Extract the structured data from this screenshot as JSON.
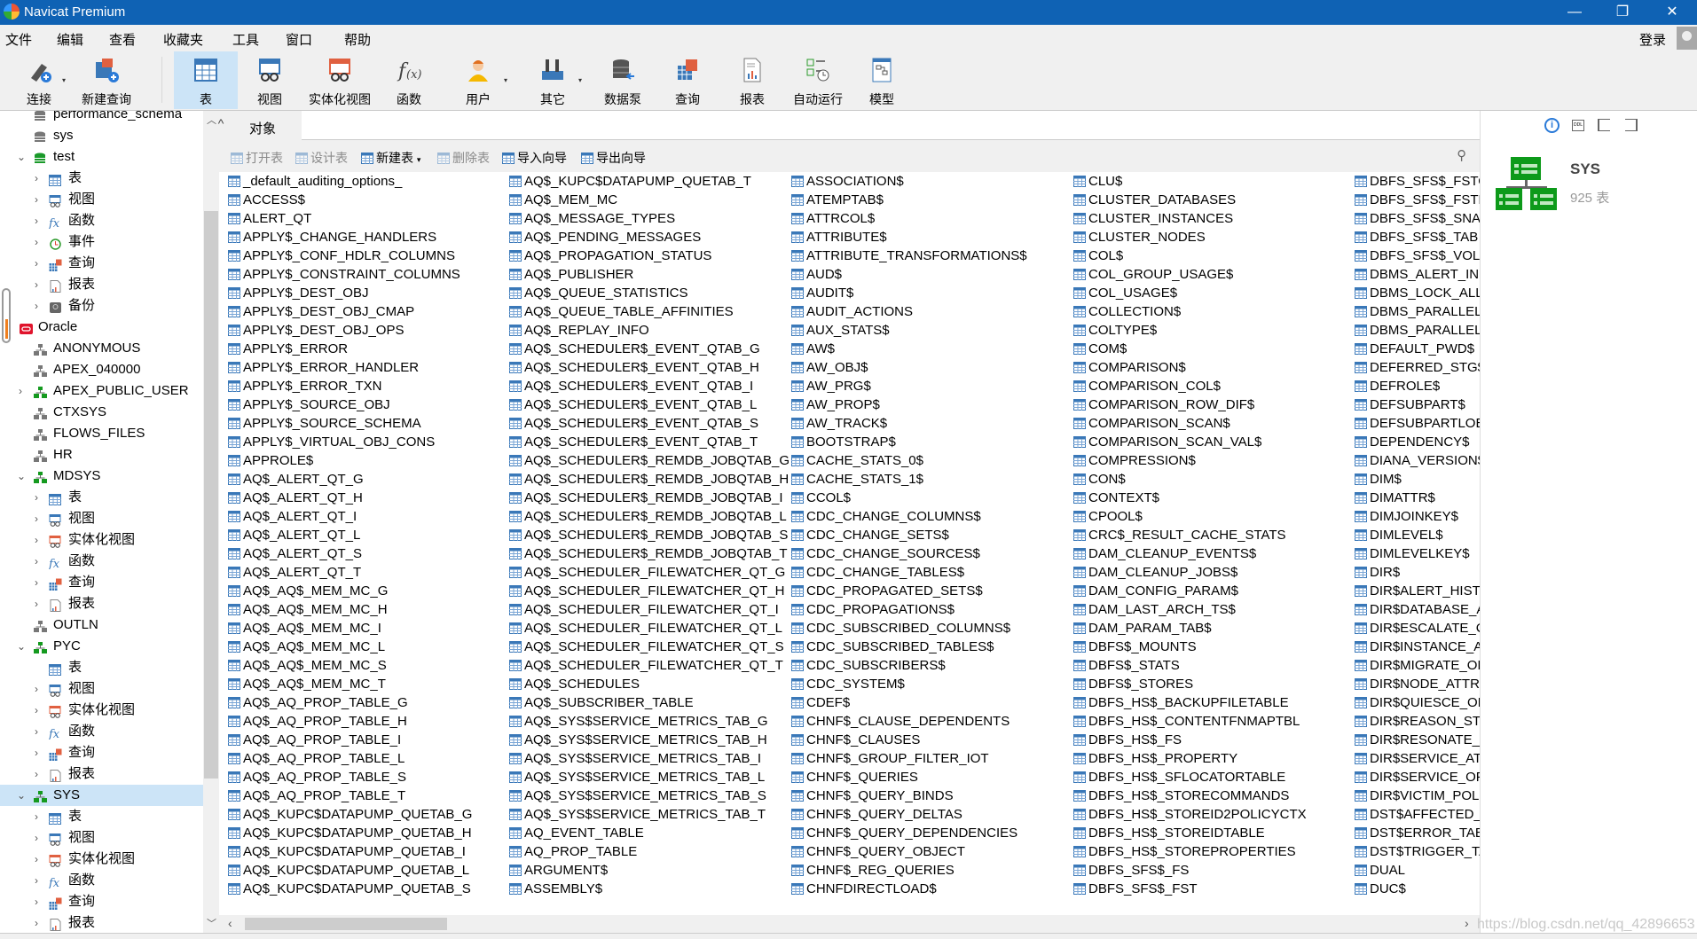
{
  "window": {
    "title": "Navicat Premium",
    "minimize": "—",
    "restore": "❐",
    "close": "✕"
  },
  "menu": [
    "文件",
    "编辑",
    "查看",
    "收藏夹",
    "工具",
    "窗口",
    "帮助"
  ],
  "login": "登录",
  "toolbar": [
    {
      "label": "连接",
      "icon": "connection-icon",
      "drop": true
    },
    {
      "label": "新建查询",
      "icon": "new-query-icon"
    },
    {
      "label": "表",
      "icon": "table-icon",
      "selected": true
    },
    {
      "label": "视图",
      "icon": "view-icon"
    },
    {
      "label": "实体化视图",
      "icon": "materialized-view-icon"
    },
    {
      "label": "函数",
      "icon": "function-icon"
    },
    {
      "label": "用户",
      "icon": "user-icon",
      "drop": true
    },
    {
      "label": "其它",
      "icon": "tools-icon",
      "drop": true
    },
    {
      "label": "数据泵",
      "icon": "data-pump-icon"
    },
    {
      "label": "查询",
      "icon": "query-icon"
    },
    {
      "label": "报表",
      "icon": "report-icon"
    },
    {
      "label": "自动运行",
      "icon": "automation-icon"
    },
    {
      "label": "模型",
      "icon": "model-icon"
    }
  ],
  "sidebar": [
    {
      "label": "performance_schema",
      "level": 1,
      "icon": "database-grey"
    },
    {
      "label": "sys",
      "level": 1,
      "icon": "database-grey"
    },
    {
      "label": "test",
      "level": 1,
      "icon": "database-green",
      "expanded": true
    },
    {
      "label": "表",
      "level": 2,
      "icon": "table",
      "chev": true
    },
    {
      "label": "视图",
      "level": 2,
      "icon": "view",
      "chev": true
    },
    {
      "label": "函数",
      "level": 2,
      "icon": "function",
      "chev": true
    },
    {
      "label": "事件",
      "level": 2,
      "icon": "event",
      "chev": true
    },
    {
      "label": "查询",
      "level": 2,
      "icon": "query",
      "chev": true
    },
    {
      "label": "报表",
      "level": 2,
      "icon": "report",
      "chev": true
    },
    {
      "label": "备份",
      "level": 2,
      "icon": "backup",
      "chev": true
    },
    {
      "label": "Oracle",
      "level": 0,
      "icon": "oracle"
    },
    {
      "label": "ANONYMOUS",
      "level": 1,
      "icon": "schema-grey"
    },
    {
      "label": "APEX_040000",
      "level": 1,
      "icon": "schema-grey"
    },
    {
      "label": "APEX_PUBLIC_USER",
      "level": 1,
      "icon": "schema-green",
      "chev": true
    },
    {
      "label": "CTXSYS",
      "level": 1,
      "icon": "schema-grey"
    },
    {
      "label": "FLOWS_FILES",
      "level": 1,
      "icon": "schema-grey"
    },
    {
      "label": "HR",
      "level": 1,
      "icon": "schema-grey"
    },
    {
      "label": "MDSYS",
      "level": 1,
      "icon": "schema-green",
      "expanded": true
    },
    {
      "label": "表",
      "level": 2,
      "icon": "table",
      "chev": true
    },
    {
      "label": "视图",
      "level": 2,
      "icon": "view",
      "chev": true
    },
    {
      "label": "实体化视图",
      "level": 2,
      "icon": "mview",
      "chev": true
    },
    {
      "label": "函数",
      "level": 2,
      "icon": "function",
      "chev": true
    },
    {
      "label": "查询",
      "level": 2,
      "icon": "query",
      "chev": true
    },
    {
      "label": "报表",
      "level": 2,
      "icon": "report",
      "chev": true
    },
    {
      "label": "OUTLN",
      "level": 1,
      "icon": "schema-grey"
    },
    {
      "label": "PYC",
      "level": 1,
      "icon": "schema-green",
      "expanded": true
    },
    {
      "label": "表",
      "level": 2,
      "icon": "table"
    },
    {
      "label": "视图",
      "level": 2,
      "icon": "view",
      "chev": true
    },
    {
      "label": "实体化视图",
      "level": 2,
      "icon": "mview",
      "chev": true
    },
    {
      "label": "函数",
      "level": 2,
      "icon": "function",
      "chev": true
    },
    {
      "label": "查询",
      "level": 2,
      "icon": "query",
      "chev": true
    },
    {
      "label": "报表",
      "level": 2,
      "icon": "report",
      "chev": true
    },
    {
      "label": "SYS",
      "level": 1,
      "icon": "schema-green",
      "expanded": true,
      "selected": true
    },
    {
      "label": "表",
      "level": 2,
      "icon": "table",
      "chev": true
    },
    {
      "label": "视图",
      "level": 2,
      "icon": "view",
      "chev": true
    },
    {
      "label": "实体化视图",
      "level": 2,
      "icon": "mview",
      "chev": true
    },
    {
      "label": "函数",
      "level": 2,
      "icon": "function",
      "chev": true
    },
    {
      "label": "查询",
      "level": 2,
      "icon": "query",
      "chev": true
    },
    {
      "label": "报表",
      "level": 2,
      "icon": "report",
      "chev": true
    }
  ],
  "tabs": {
    "collapse": "^",
    "active": "对象"
  },
  "object_toolbar": [
    {
      "label": "打开表",
      "disabled": true
    },
    {
      "label": "设计表",
      "disabled": true
    },
    {
      "label": "新建表",
      "disabled": false,
      "drop": true
    },
    {
      "label": "删除表",
      "disabled": true
    },
    {
      "label": "导入向导",
      "disabled": false
    },
    {
      "label": "导出向导",
      "disabled": false
    }
  ],
  "tables": [
    [
      "_default_auditing_options_",
      "ACCESS$",
      "ALERT_QT",
      "APPLY$_CHANGE_HANDLERS",
      "APPLY$_CONF_HDLR_COLUMNS",
      "APPLY$_CONSTRAINT_COLUMNS",
      "APPLY$_DEST_OBJ",
      "APPLY$_DEST_OBJ_CMAP",
      "APPLY$_DEST_OBJ_OPS",
      "APPLY$_ERROR",
      "APPLY$_ERROR_HANDLER",
      "APPLY$_ERROR_TXN",
      "APPLY$_SOURCE_OBJ",
      "APPLY$_SOURCE_SCHEMA",
      "APPLY$_VIRTUAL_OBJ_CONS",
      "APPROLE$",
      "AQ$_ALERT_QT_G",
      "AQ$_ALERT_QT_H",
      "AQ$_ALERT_QT_I",
      "AQ$_ALERT_QT_L",
      "AQ$_ALERT_QT_S",
      "AQ$_ALERT_QT_T",
      "AQ$_AQ$_MEM_MC_G",
      "AQ$_AQ$_MEM_MC_H",
      "AQ$_AQ$_MEM_MC_I",
      "AQ$_AQ$_MEM_MC_L",
      "AQ$_AQ$_MEM_MC_S",
      "AQ$_AQ$_MEM_MC_T",
      "AQ$_AQ_PROP_TABLE_G",
      "AQ$_AQ_PROP_TABLE_H",
      "AQ$_AQ_PROP_TABLE_I",
      "AQ$_AQ_PROP_TABLE_L",
      "AQ$_AQ_PROP_TABLE_S",
      "AQ$_AQ_PROP_TABLE_T",
      "AQ$_KUPC$DATAPUMP_QUETAB_G",
      "AQ$_KUPC$DATAPUMP_QUETAB_H",
      "AQ$_KUPC$DATAPUMP_QUETAB_I",
      "AQ$_KUPC$DATAPUMP_QUETAB_L",
      "AQ$_KUPC$DATAPUMP_QUETAB_S"
    ],
    [
      "AQ$_KUPC$DATAPUMP_QUETAB_T",
      "AQ$_MEM_MC",
      "AQ$_MESSAGE_TYPES",
      "AQ$_PENDING_MESSAGES",
      "AQ$_PROPAGATION_STATUS",
      "AQ$_PUBLISHER",
      "AQ$_QUEUE_STATISTICS",
      "AQ$_QUEUE_TABLE_AFFINITIES",
      "AQ$_REPLAY_INFO",
      "AQ$_SCHEDULER$_EVENT_QTAB_G",
      "AQ$_SCHEDULER$_EVENT_QTAB_H",
      "AQ$_SCHEDULER$_EVENT_QTAB_I",
      "AQ$_SCHEDULER$_EVENT_QTAB_L",
      "AQ$_SCHEDULER$_EVENT_QTAB_S",
      "AQ$_SCHEDULER$_EVENT_QTAB_T",
      "AQ$_SCHEDULER$_REMDB_JOBQTAB_G",
      "AQ$_SCHEDULER$_REMDB_JOBQTAB_H",
      "AQ$_SCHEDULER$_REMDB_JOBQTAB_I",
      "AQ$_SCHEDULER$_REMDB_JOBQTAB_L",
      "AQ$_SCHEDULER$_REMDB_JOBQTAB_S",
      "AQ$_SCHEDULER$_REMDB_JOBQTAB_T",
      "AQ$_SCHEDULER_FILEWATCHER_QT_G",
      "AQ$_SCHEDULER_FILEWATCHER_QT_H",
      "AQ$_SCHEDULER_FILEWATCHER_QT_I",
      "AQ$_SCHEDULER_FILEWATCHER_QT_L",
      "AQ$_SCHEDULER_FILEWATCHER_QT_S",
      "AQ$_SCHEDULER_FILEWATCHER_QT_T",
      "AQ$_SCHEDULES",
      "AQ$_SUBSCRIBER_TABLE",
      "AQ$_SYS$SERVICE_METRICS_TAB_G",
      "AQ$_SYS$SERVICE_METRICS_TAB_H",
      "AQ$_SYS$SERVICE_METRICS_TAB_I",
      "AQ$_SYS$SERVICE_METRICS_TAB_L",
      "AQ$_SYS$SERVICE_METRICS_TAB_S",
      "AQ$_SYS$SERVICE_METRICS_TAB_T",
      "AQ_EVENT_TABLE",
      "AQ_PROP_TABLE",
      "ARGUMENT$",
      "ASSEMBLY$"
    ],
    [
      "ASSOCIATION$",
      "ATEMPTAB$",
      "ATTRCOL$",
      "ATTRIBUTE$",
      "ATTRIBUTE_TRANSFORMATIONS$",
      "AUD$",
      "AUDIT$",
      "AUDIT_ACTIONS",
      "AUX_STATS$",
      "AW$",
      "AW_OBJ$",
      "AW_PRG$",
      "AW_PROP$",
      "AW_TRACK$",
      "BOOTSTRAP$",
      "CACHE_STATS_0$",
      "CACHE_STATS_1$",
      "CCOL$",
      "CDC_CHANGE_COLUMNS$",
      "CDC_CHANGE_SETS$",
      "CDC_CHANGE_SOURCES$",
      "CDC_CHANGE_TABLES$",
      "CDC_PROPAGATED_SETS$",
      "CDC_PROPAGATIONS$",
      "CDC_SUBSCRIBED_COLUMNS$",
      "CDC_SUBSCRIBED_TABLES$",
      "CDC_SUBSCRIBERS$",
      "CDC_SYSTEM$",
      "CDEF$",
      "CHNF$_CLAUSE_DEPENDENTS",
      "CHNF$_CLAUSES",
      "CHNF$_GROUP_FILTER_IOT",
      "CHNF$_QUERIES",
      "CHNF$_QUERY_BINDS",
      "CHNF$_QUERY_DELTAS",
      "CHNF$_QUERY_DEPENDENCIES",
      "CHNF$_QUERY_OBJECT",
      "CHNF$_REG_QUERIES",
      "CHNFDIRECTLOAD$"
    ],
    [
      "CLU$",
      "CLUSTER_DATABASES",
      "CLUSTER_INSTANCES",
      "CLUSTER_NODES",
      "COL$",
      "COL_GROUP_USAGE$",
      "COL_USAGE$",
      "COLLECTION$",
      "COLTYPE$",
      "COM$",
      "COMPARISON$",
      "COMPARISON_COL$",
      "COMPARISON_ROW_DIF$",
      "COMPARISON_SCAN$",
      "COMPARISON_SCAN_VAL$",
      "COMPRESSION$",
      "CON$",
      "CONTEXT$",
      "CPOOL$",
      "CRC$_RESULT_CACHE_STATS",
      "DAM_CLEANUP_EVENTS$",
      "DAM_CLEANUP_JOBS$",
      "DAM_CONFIG_PARAM$",
      "DAM_LAST_ARCH_TS$",
      "DAM_PARAM_TAB$",
      "DBFS$_MOUNTS",
      "DBFS$_STATS",
      "DBFS$_STORES",
      "DBFS_HS$_BACKUPFILETABLE",
      "DBFS_HS$_CONTENTFNMAPTBL",
      "DBFS_HS$_FS",
      "DBFS_HS$_PROPERTY",
      "DBFS_HS$_SFLOCATORTABLE",
      "DBFS_HS$_STORECOMMANDS",
      "DBFS_HS$_STOREID2POLICYCTX",
      "DBFS_HS$_STOREIDTABLE",
      "DBFS_HS$_STOREPROPERTIES",
      "DBFS_SFS$_FS",
      "DBFS_SFS$_FST"
    ],
    [
      "DBFS_SFS$_FSTO",
      "DBFS_SFS$_FSTP",
      "DBFS_SFS$_SNAP",
      "DBFS_SFS$_TAB",
      "DBFS_SFS$_VOL",
      "DBMS_ALERT_INI",
      "DBMS_LOCK_ALL",
      "DBMS_PARALLEL",
      "DBMS_PARALLEL",
      "DEFAULT_PWD$",
      "DEFERRED_STG$",
      "DEFROLE$",
      "DEFSUBPART$",
      "DEFSUBPARTLOB",
      "DEPENDENCY$",
      "DIANA_VERSION$",
      "DIM$",
      "DIMATTR$",
      "DIMJOINKEY$",
      "DIMLEVEL$",
      "DIMLEVELKEY$",
      "DIR$",
      "DIR$ALERT_HIST",
      "DIR$DATABASE_A",
      "DIR$ESCALATE_C",
      "DIR$INSTANCE_A",
      "DIR$MIGRATE_OI",
      "DIR$NODE_ATTR",
      "DIR$QUIESCE_OP",
      "DIR$REASON_STI",
      "DIR$RESONATE_C",
      "DIR$SERVICE_ATT",
      "DIR$SERVICE_OPI",
      "DIR$VICTIM_POL",
      "DST$AFFECTED_T",
      "DST$ERROR_TAB",
      "DST$TRIGGER_TA",
      "DUAL",
      "DUC$"
    ]
  ],
  "info_panel": {
    "name": "SYS",
    "count": "925 表",
    "icons": [
      "info-icon",
      "ddl-icon",
      "er-left-icon",
      "er-right-icon"
    ]
  },
  "watermark": "https://blog.csdn.net/qq_42896653",
  "colors": {
    "titlebar": "#0f62b4",
    "selected": "#cce4f7",
    "table_icon": "#3a78b8",
    "schema_green": "#159a1f"
  }
}
